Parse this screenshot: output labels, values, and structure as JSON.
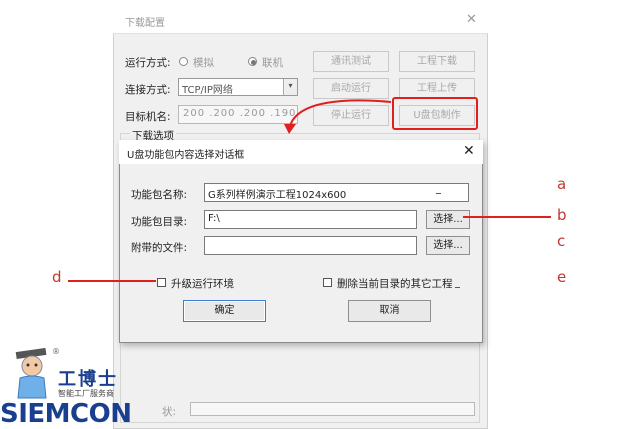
{
  "background_window": {
    "title": "下载配置",
    "close_glyph": "✕",
    "run_mode_label": "运行方式:",
    "run_mode_options": [
      "模拟",
      "联机"
    ],
    "connect_label": "连接方式:",
    "connect_value": "TCP/IP网络",
    "target_label": "目标机名:",
    "target_value": "200 .200 .200 .190",
    "group_label": "下载选项",
    "buttons": {
      "comm_test": "通讯测试",
      "project_download": "工程下载",
      "start_run": "启动运行",
      "project_upload": "工程上传",
      "stop_run": "停止运行",
      "usb_make": "U盘包制作"
    },
    "bottom_label": "状:"
  },
  "dialog": {
    "title": "U盘功能包内容选择对话框",
    "close_glyph": "✕",
    "package_name_label": "功能包名称:",
    "package_name_value": "G系列样例演示工程1024x600",
    "package_dir_label": "功能包目录:",
    "package_dir_value": "F:\\",
    "attached_label": "附带的文件:",
    "attached_value": "",
    "browse_label": "选择...",
    "upgrade_env_label": "升级运行环境",
    "delete_others_label": "删除当前目录的其它工程",
    "ok_label": "确定",
    "cancel_label": "取消"
  },
  "annotations": {
    "a": "a",
    "b": "b",
    "c": "c",
    "d": "d",
    "e": "e"
  },
  "watermark": {
    "brand": "SIEMCON",
    "cn_name": "工博士",
    "slogan": "智能工厂服务商",
    "registered": "®"
  },
  "colors": {
    "annotation_red": "#e01f1f",
    "brand_blue": "#1a3f8f"
  }
}
